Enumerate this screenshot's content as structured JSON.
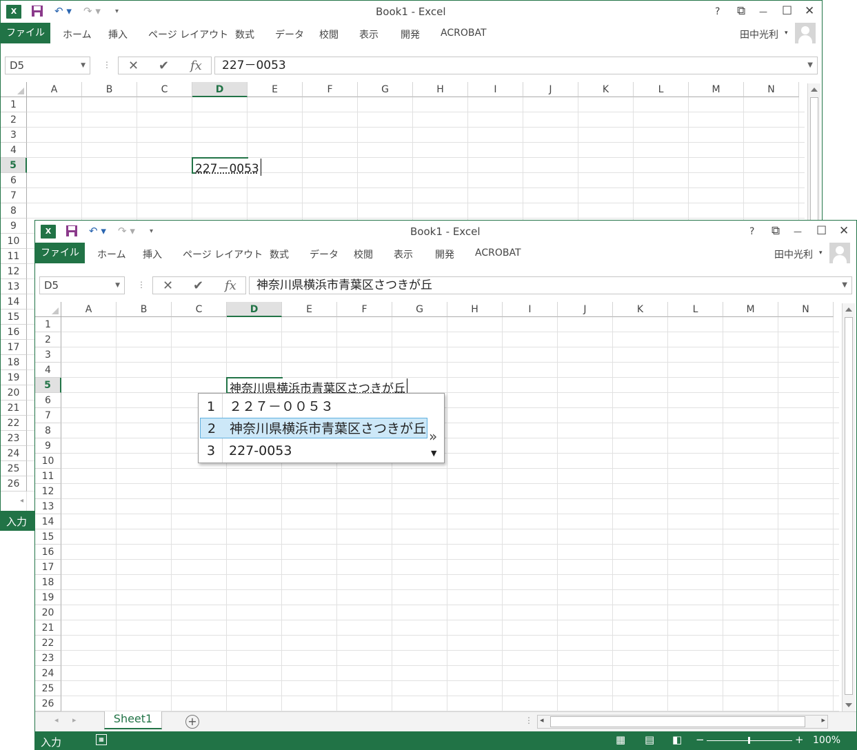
{
  "app": {
    "title": "Book1 - Excel",
    "accent": "#217346",
    "icon_label": "X"
  },
  "ribbon": {
    "tabs": [
      "ファイル",
      "ホーム",
      "挿入",
      "ページ レイアウト",
      "数式",
      "データ",
      "校閲",
      "表示",
      "開発",
      "ACROBAT"
    ],
    "user": "田中光利"
  },
  "caption_buttons": {
    "help": "?",
    "restore_ribbon": "⧉",
    "minimize": "—",
    "maximize": "☐",
    "close": "✕"
  },
  "formula_bar": {
    "cancel": "✕",
    "enter": "✔",
    "fx": "fx",
    "dots": "⋮"
  },
  "columns": [
    "A",
    "B",
    "C",
    "D",
    "E",
    "F",
    "G",
    "H",
    "I",
    "J",
    "K",
    "L",
    "M",
    "N"
  ],
  "back_window": {
    "name_box": "D5",
    "formula": "227－0053",
    "cell_value": "227－0053",
    "rows": [
      "1",
      "2",
      "3",
      "4",
      "5",
      "6",
      "7",
      "8",
      "9",
      "10",
      "11",
      "12",
      "13",
      "14",
      "15",
      "16",
      "17",
      "18",
      "19",
      "20",
      "21",
      "22",
      "23",
      "24",
      "25",
      "26"
    ],
    "status": "入力"
  },
  "front_window": {
    "name_box": "D5",
    "formula": "神奈川県横浜市青葉区さつきが丘",
    "cell_value": "神奈川県横浜市青葉区さつきが丘",
    "rows": [
      "1",
      "2",
      "3",
      "4",
      "5",
      "6",
      "7",
      "8",
      "9",
      "10",
      "11",
      "12",
      "13",
      "14",
      "15",
      "16",
      "17",
      "18",
      "19",
      "20",
      "21",
      "22",
      "23",
      "24",
      "25",
      "26"
    ],
    "sheet_tab": "Sheet1",
    "add_sheet": "+",
    "status": "入力",
    "zoom": "100%"
  },
  "ime_candidates": {
    "items": [
      {
        "num": "1",
        "text": "２２７－００５３"
      },
      {
        "num": "2",
        "text": "神奈川県横浜市青葉区さつきが丘"
      },
      {
        "num": "3",
        "text": "227-0053"
      }
    ],
    "selected_index": 1,
    "expand_icon": "»"
  }
}
